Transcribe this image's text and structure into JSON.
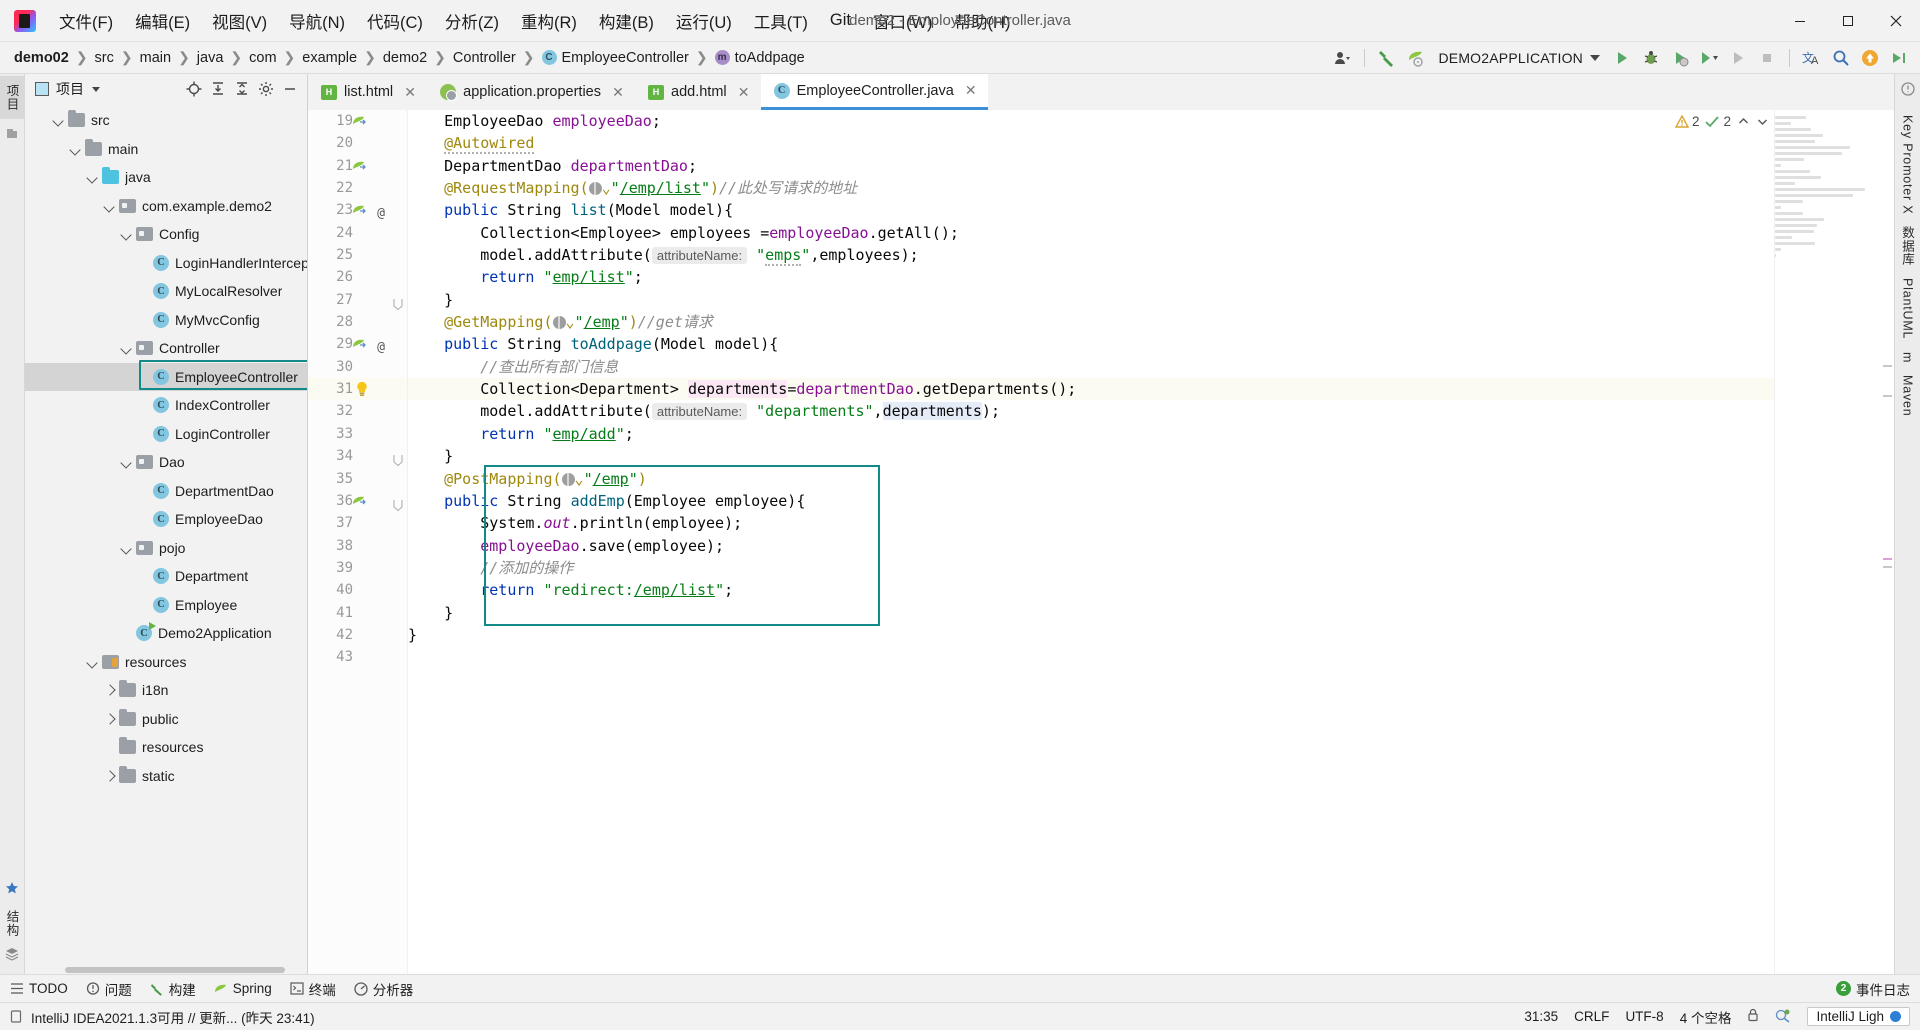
{
  "window": {
    "title": "demo2 - EmployeeController.java",
    "logo_name": "intellij-idea-logo",
    "minimize": "—",
    "maximize": "▢",
    "close": "✕"
  },
  "menubar": {
    "items": [
      {
        "label": "文件(F)",
        "name": "menu-file"
      },
      {
        "label": "编辑(E)",
        "name": "menu-edit"
      },
      {
        "label": "视图(V)",
        "name": "menu-view"
      },
      {
        "label": "导航(N)",
        "name": "menu-navigate"
      },
      {
        "label": "代码(C)",
        "name": "menu-code"
      },
      {
        "label": "分析(Z)",
        "name": "menu-analyze"
      },
      {
        "label": "重构(R)",
        "name": "menu-refactor"
      },
      {
        "label": "构建(B)",
        "name": "menu-build"
      },
      {
        "label": "运行(U)",
        "name": "menu-run"
      },
      {
        "label": "工具(T)",
        "name": "menu-tools"
      },
      {
        "label": "Git",
        "name": "menu-git"
      },
      {
        "label": "窗口(W)",
        "name": "menu-window"
      },
      {
        "label": "帮助(H)",
        "name": "menu-help"
      }
    ]
  },
  "breadcrumb": {
    "items": [
      {
        "label": "demo02",
        "bold": true,
        "icon": ""
      },
      {
        "label": "src",
        "bold": false,
        "icon": ""
      },
      {
        "label": "main",
        "bold": false,
        "icon": ""
      },
      {
        "label": "java",
        "bold": false,
        "icon": ""
      },
      {
        "label": "com",
        "bold": false,
        "icon": ""
      },
      {
        "label": "example",
        "bold": false,
        "icon": ""
      },
      {
        "label": "demo2",
        "bold": false,
        "icon": ""
      },
      {
        "label": "Controller",
        "bold": false,
        "icon": ""
      },
      {
        "label": "EmployeeController",
        "bold": false,
        "icon": "C"
      },
      {
        "label": "toAddpage",
        "bold": false,
        "icon": "m"
      }
    ],
    "separator": "❯"
  },
  "toolbar": {
    "run_config": "DEMO2APPLICATION",
    "icons": [
      {
        "name": "user-avatar-icon"
      },
      {
        "name": "build-hammer-icon"
      },
      {
        "name": "spring-boot-icon"
      },
      {
        "name": "run-icon"
      },
      {
        "name": "debug-icon"
      },
      {
        "name": "run-with-coverage-icon"
      },
      {
        "name": "profiler-icon"
      },
      {
        "name": "run-dropdown-icon"
      },
      {
        "name": "rerun-icon"
      },
      {
        "name": "stop-icon"
      },
      {
        "name": "translate-icon"
      },
      {
        "name": "search-everywhere-icon"
      },
      {
        "name": "update-icon"
      },
      {
        "name": "run-anything-icon"
      }
    ]
  },
  "project_panel": {
    "title": "项目",
    "actions": [
      {
        "name": "locate-file-icon"
      },
      {
        "name": "expand-all-icon"
      },
      {
        "name": "collapse-all-icon"
      },
      {
        "name": "settings-gear-icon"
      },
      {
        "name": "hide-panel-icon"
      }
    ],
    "tree": [
      {
        "label": "src",
        "indent": 1,
        "arrow": "down",
        "icon": "folder",
        "selected": false
      },
      {
        "label": "main",
        "indent": 2,
        "arrow": "down",
        "icon": "folder",
        "selected": false
      },
      {
        "label": "java",
        "indent": 3,
        "arrow": "down",
        "icon": "folder-blue",
        "selected": false
      },
      {
        "label": "com.example.demo2",
        "indent": 4,
        "arrow": "down",
        "icon": "pkg",
        "selected": false
      },
      {
        "label": "Config",
        "indent": 5,
        "arrow": "down",
        "icon": "pkg",
        "selected": false
      },
      {
        "label": "LoginHandlerInterceptor",
        "indent": 6,
        "arrow": "none",
        "icon": "class",
        "selected": false
      },
      {
        "label": "MyLocalResolver",
        "indent": 6,
        "arrow": "none",
        "icon": "class",
        "selected": false
      },
      {
        "label": "MyMvcConfig",
        "indent": 6,
        "arrow": "none",
        "icon": "class",
        "selected": false
      },
      {
        "label": "Controller",
        "indent": 5,
        "arrow": "down",
        "icon": "pkg",
        "selected": false
      },
      {
        "label": "EmployeeController",
        "indent": 6,
        "arrow": "none",
        "icon": "class",
        "selected": true
      },
      {
        "label": "IndexController",
        "indent": 6,
        "arrow": "none",
        "icon": "class",
        "selected": false
      },
      {
        "label": "LoginController",
        "indent": 6,
        "arrow": "none",
        "icon": "class",
        "selected": false
      },
      {
        "label": "Dao",
        "indent": 5,
        "arrow": "down",
        "icon": "pkg",
        "selected": false
      },
      {
        "label": "DepartmentDao",
        "indent": 6,
        "arrow": "none",
        "icon": "class",
        "selected": false
      },
      {
        "label": "EmployeeDao",
        "indent": 6,
        "arrow": "none",
        "icon": "class",
        "selected": false
      },
      {
        "label": "pojo",
        "indent": 5,
        "arrow": "down",
        "icon": "pkg",
        "selected": false
      },
      {
        "label": "Department",
        "indent": 6,
        "arrow": "none",
        "icon": "class",
        "selected": false
      },
      {
        "label": "Employee",
        "indent": 6,
        "arrow": "none",
        "icon": "class",
        "selected": false
      },
      {
        "label": "Demo2Application",
        "indent": 5,
        "arrow": "none",
        "icon": "class-runnable",
        "selected": false
      },
      {
        "label": "resources",
        "indent": 3,
        "arrow": "down",
        "icon": "res",
        "selected": false
      },
      {
        "label": "i18n",
        "indent": 4,
        "arrow": "right",
        "icon": "folder",
        "selected": false
      },
      {
        "label": "public",
        "indent": 4,
        "arrow": "right",
        "icon": "folder",
        "selected": false
      },
      {
        "label": "resources",
        "indent": 4,
        "arrow": "none",
        "icon": "folder",
        "selected": false
      },
      {
        "label": "static",
        "indent": 4,
        "arrow": "right",
        "icon": "folder",
        "selected": false
      }
    ]
  },
  "left_strip": {
    "project_tab": "项目",
    "bookmark_icon": "bookmark-icon",
    "structure_tab": "结构",
    "favorites_icon": "favorites-star-icon"
  },
  "right_strip": {
    "tabs": [
      "Key Promoter X",
      "数据库",
      "PlantUML",
      "m",
      "Maven"
    ]
  },
  "tabs": [
    {
      "label": "list.html",
      "icon": "html-file-icon",
      "active": false
    },
    {
      "label": "application.properties",
      "icon": "spring-properties-icon",
      "active": false
    },
    {
      "label": "add.html",
      "icon": "html-file-icon",
      "active": false
    },
    {
      "label": "EmployeeController.java",
      "icon": "java-class-icon",
      "active": true
    }
  ],
  "inspections": {
    "warnings": "2",
    "checks": "2",
    "up_arrow": "⌃",
    "down_arrow": "⌄"
  },
  "code": {
    "first_line": 19,
    "highlight_line": 31,
    "lines": [
      {
        "n": 19,
        "html": "    EmployeeDao <span class=\"fld\">employeeDao</span>;",
        "gutter": "bean"
      },
      {
        "n": 20,
        "html": "    <span class=\"ann wavy\">@Autowired</span>",
        "gutter": ""
      },
      {
        "n": 21,
        "html": "    DepartmentDao <span class=\"fld\">departmentDao</span>;",
        "gutter": "bean"
      },
      {
        "n": 22,
        "html": "    <span class=\"ann\">@RequestMapping(</span><span class=\"webicon\"></span><span class=\"ann\">⌄</span><span class=\"str\">\"</span><span class=\"str ulink\">/emp/list</span><span class=\"str\">\"</span><span class=\"ann\">)</span><span class=\"cmt\">//此处写请求的地址</span>",
        "gutter": ""
      },
      {
        "n": 23,
        "html": "    <span class=\"kw\">public</span> String <span class=\"mth\">list</span>(Model model){",
        "gutter": "bean-at"
      },
      {
        "n": 24,
        "html": "        Collection&lt;Employee&gt; employees =<span class=\"fld\">employeeDao</span>.getAll();",
        "gutter": ""
      },
      {
        "n": 25,
        "html": "        model.addAttribute(<span class=\"hintlbl\">attributeName:</span> <span class=\"str\">\"</span><span class=\"str wavy\">emps</span><span class=\"str\">\"</span>,employees);",
        "gutter": ""
      },
      {
        "n": 26,
        "html": "        <span class=\"kw\">return</span> <span class=\"str\">\"</span><span class=\"str ulink\">emp/list</span><span class=\"str\">\"</span>;",
        "gutter": ""
      },
      {
        "n": 27,
        "html": "    }",
        "gutter": "fold"
      },
      {
        "n": 28,
        "html": "    <span class=\"ann\">@GetMapping(</span><span class=\"webicon\"></span><span class=\"ann\">⌄</span><span class=\"str\">\"</span><span class=\"str ulink\">/emp</span><span class=\"str\">\"</span><span class=\"ann\">)</span><span class=\"cmt\">//get请求</span>",
        "gutter": ""
      },
      {
        "n": 29,
        "html": "    <span class=\"kw\">public</span> String <span class=\"mth\">toAddpage</span>(Model model){",
        "gutter": "bean-at"
      },
      {
        "n": 30,
        "html": "        <span class=\"cmt\">//查出所有部门信息</span>",
        "gutter": ""
      },
      {
        "n": 31,
        "html": "        Collection&lt;Department&gt; <span class=\"hl-pink\">departments</span>=<span class=\"fld\">departmentDao</span>.getDepartments();",
        "gutter": "bulb"
      },
      {
        "n": 32,
        "html": "        model.addAttribute(<span class=\"hintlbl\">attributeName:</span> <span class=\"str\">\"departments\"</span>,<span class=\"hl-blue\">departments</span>);",
        "gutter": ""
      },
      {
        "n": 33,
        "html": "        <span class=\"kw\">return</span> <span class=\"str\">\"</span><span class=\"str ulink\">emp/add</span><span class=\"str\">\"</span>;",
        "gutter": ""
      },
      {
        "n": 34,
        "html": "    }",
        "gutter": "fold"
      },
      {
        "n": 35,
        "html": "    <span class=\"ann\">@PostMapping(</span><span class=\"webicon\"></span><span class=\"ann\">⌄</span><span class=\"str\">\"</span><span class=\"str ulink\">/emp</span><span class=\"str\">\"</span><span class=\"ann\">)</span>",
        "gutter": ""
      },
      {
        "n": 36,
        "html": "    <span class=\"kw\">public</span> String <span class=\"mth\">addEmp</span>(Employee employee){",
        "gutter": "bean-fold"
      },
      {
        "n": 37,
        "html": "        System.<span class=\"fld\" style=\"font-style:italic\">out</span>.println(employee);",
        "gutter": ""
      },
      {
        "n": 38,
        "html": "        <span class=\"fld\">employeeDao</span>.save(employee);",
        "gutter": ""
      },
      {
        "n": 39,
        "html": "        <span class=\"cmt\">//添加的操作</span>",
        "gutter": ""
      },
      {
        "n": 40,
        "html": "        <span class=\"kw\">return</span> <span class=\"str\">\"redirect:</span><span class=\"str ulink\">/emp/list</span><span class=\"str\">\"</span>;",
        "gutter": ""
      },
      {
        "n": 41,
        "html": "    }",
        "gutter": ""
      },
      {
        "n": 42,
        "html": "}",
        "gutter": ""
      },
      {
        "n": 43,
        "html": "",
        "gutter": ""
      }
    ]
  },
  "bottom_toolbar": {
    "items": [
      {
        "label": "TODO",
        "icon": "todo-icon"
      },
      {
        "label": "问题",
        "icon": "problems-icon"
      },
      {
        "label": "构建",
        "icon": "build-icon"
      },
      {
        "label": "Spring",
        "icon": "spring-icon"
      },
      {
        "label": "终端",
        "icon": "terminal-icon"
      },
      {
        "label": "分析器",
        "icon": "profiler-icon"
      }
    ],
    "event_log": "事件日志",
    "event_count": "2"
  },
  "statusbar": {
    "message": "IntelliJ IDEA2021.1.3可用 // 更新... (昨天 23:41)",
    "caret": "31:35",
    "line_separator": "CRLF",
    "encoding": "UTF-8",
    "indent": "4 个空格",
    "theme": "IntelliJ Ligh",
    "lock_icon": "lock-icon",
    "inspection_icon": "inspection-icon"
  }
}
